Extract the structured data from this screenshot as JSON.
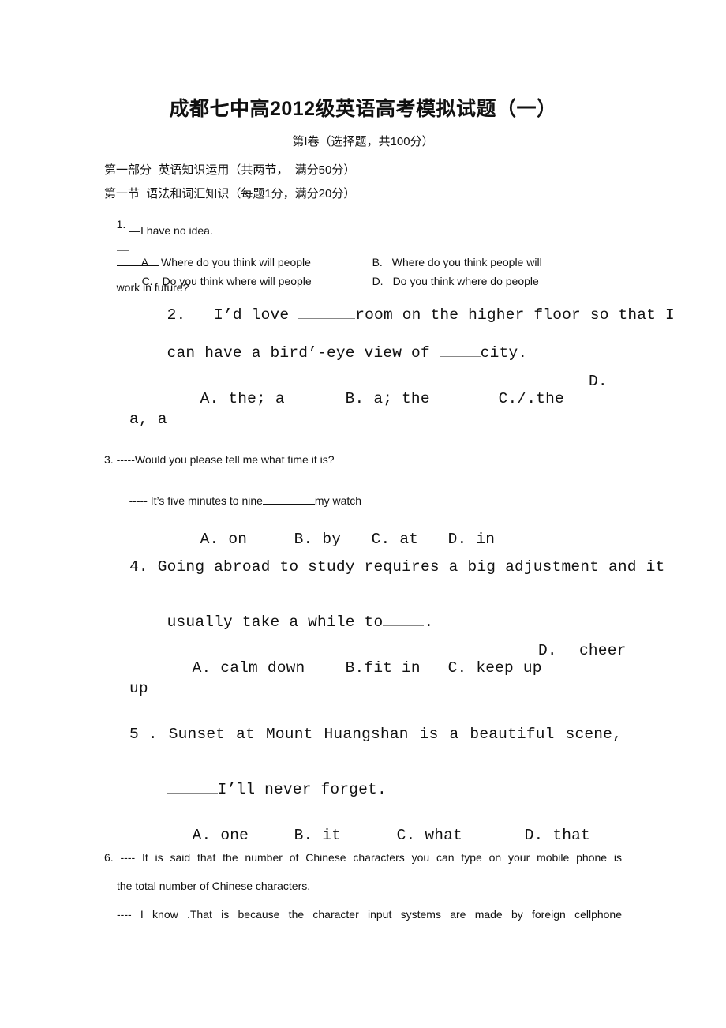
{
  "header": {
    "title": "成都七中高2012级英语高考模拟试题（一）",
    "subtitle": "第I卷（选择题，共100分）"
  },
  "sections": {
    "part1": "第一部分  英语知识运用（共两节，  满分50分）",
    "section1": "第一节  语法和词汇知识（每题1分，满分20分）"
  },
  "questions": [
    {
      "number": "1.",
      "stem_prefix": "—",
      "stem_after_blank": "work in future?",
      "reply": "—I have no idea.",
      "options": [
        {
          "letter": "A.",
          "text": "Where do you think will people"
        },
        {
          "letter": "B.",
          "text": "Where do you think people will"
        },
        {
          "letter": "C.",
          "text": "Do you think where will people"
        },
        {
          "letter": "D.",
          "text": "Do you think where do people"
        }
      ]
    },
    {
      "number": "2.",
      "line1_before_blank": "2.   I’d love ",
      "line1_after_blank": "room on the higher floor so that I",
      "line2_before_blank": "can have a bird’-eye view of ",
      "line2_after_blank": "city.",
      "options": [
        {
          "letter": "A.",
          "text": "the; a"
        },
        {
          "letter": "B.",
          "text": "a; the"
        },
        {
          "letter": "C.",
          "text": "/.the"
        },
        {
          "letter": "D.",
          "text": "a, a"
        }
      ]
    },
    {
      "number": "3.",
      "line1": "3. -----Would you please tell me what time it is?",
      "line2_before_blank": "----- It’s five minutes to nine",
      "line2_after_blank": "my watch",
      "options": [
        {
          "letter": "A.",
          "text": "on"
        },
        {
          "letter": "B.",
          "text": "by"
        },
        {
          "letter": "C.",
          "text": "at"
        },
        {
          "letter": "D.",
          "text": "in"
        }
      ]
    },
    {
      "number": "4.",
      "line1": "4. Going abroad to study requires a big adjustment and it",
      "line2_before_blank": "usually take a while to",
      "line2_after_blank": ".",
      "options": [
        {
          "letter": "A.",
          "text": "calm down"
        },
        {
          "letter": "B.",
          "text": "fit in"
        },
        {
          "letter": "C.",
          "text": "keep up"
        },
        {
          "letter": "D.",
          "text": "cheer up"
        }
      ]
    },
    {
      "number": "5 .",
      "line1_words": [
        "5 .",
        "Sunset",
        "at",
        "Mount",
        "Huangshan",
        "is",
        "a",
        "beautiful",
        "scene,"
      ],
      "line2_after_blank": "I’ll never forget.",
      "options": [
        {
          "letter": "A.",
          "text": "one"
        },
        {
          "letter": "B.",
          "text": "it"
        },
        {
          "letter": "C.",
          "text": "what"
        },
        {
          "letter": "D.",
          "text": "that"
        }
      ]
    },
    {
      "number": "6.",
      "line1": "6. ---- It is said that the number of Chinese characters you can type on your mobile phone is",
      "line2": "the total number of Chinese characters.",
      "line3": "---- I know .That is because the character input systems are made by foreign cellphone"
    }
  ]
}
